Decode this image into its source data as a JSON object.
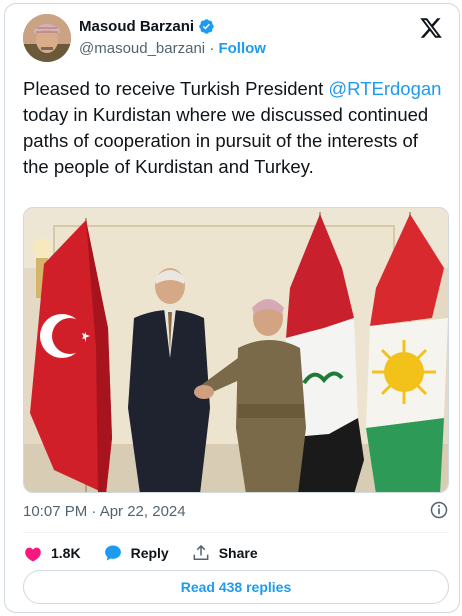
{
  "author": {
    "name": "Masoud Barzani",
    "handle": "@masoud_barzani",
    "separator": "·",
    "follow_label": "Follow"
  },
  "tweet": {
    "text_before_mention": "Pleased to receive Turkish President ",
    "mention": "@RTErdogan",
    "text_after_mention": " today in Kurdistan where we discussed continued paths of cooperation in pursuit of the interests of the people of Kurdistan and Turkey.",
    "timestamp": "10:07 PM · Apr 22, 2024"
  },
  "actions": {
    "like_count": "1.8K",
    "reply_label": "Reply",
    "share_label": "Share"
  },
  "replies_button": "Read 438 replies",
  "icons": {
    "verified": "verified-badge-icon",
    "brand": "x-logo-icon",
    "info": "info-icon",
    "like": "heart-icon",
    "reply": "speech-bubble-icon",
    "share": "share-icon"
  },
  "colors": {
    "accent": "#1d9bf0",
    "like": "#f91880",
    "text": "#0f1419",
    "muted": "#536471"
  }
}
